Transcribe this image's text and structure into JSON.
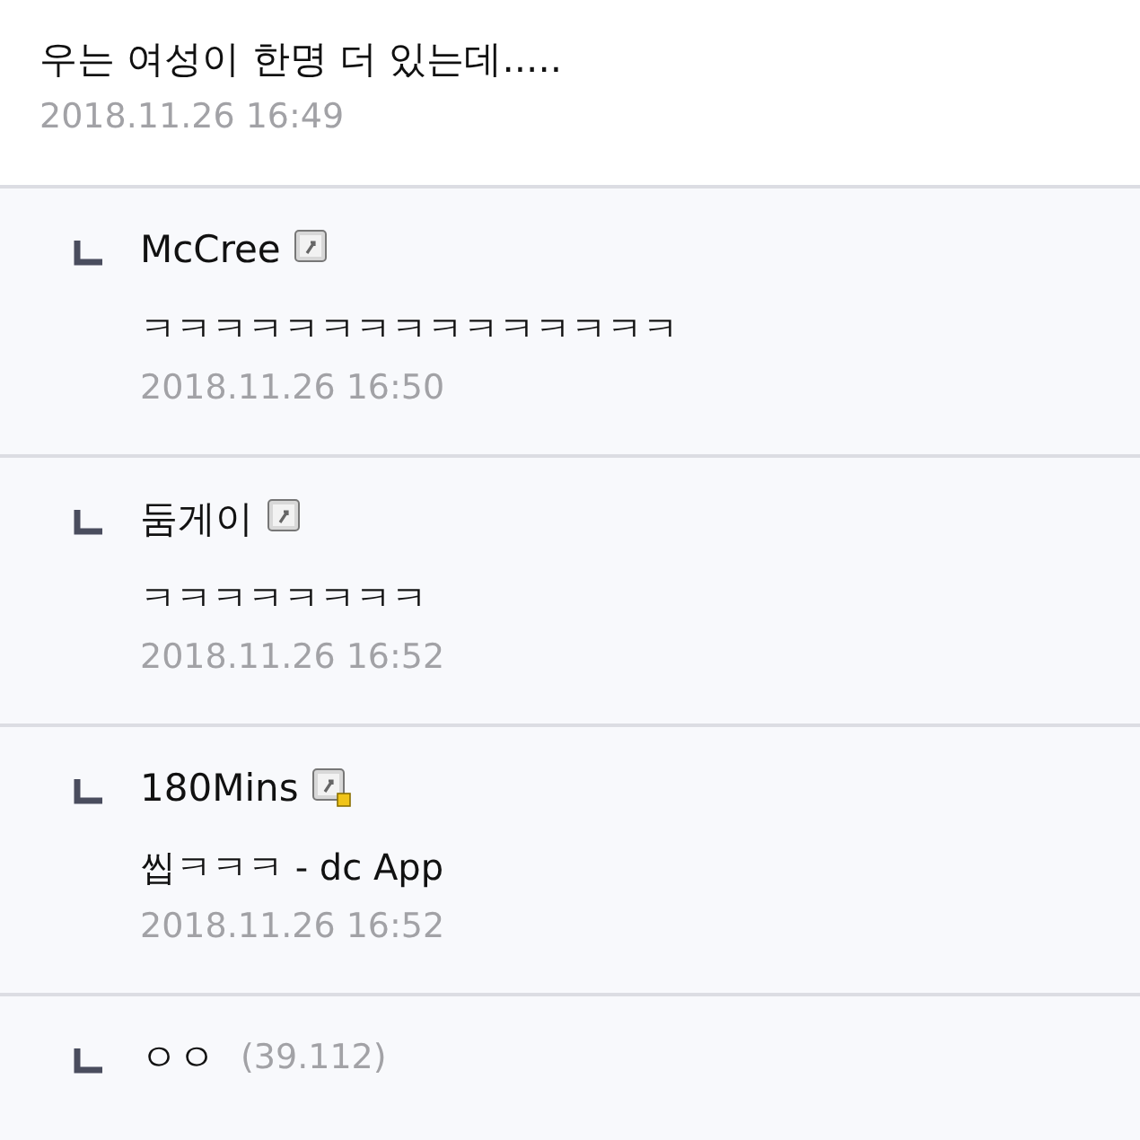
{
  "comment": {
    "text": "우는 여성이 한명 더 있는데.....",
    "date": "2018.11.26 16:49"
  },
  "replies": [
    {
      "author": "McCree",
      "kind": "fixed",
      "text": "ㅋㅋㅋㅋㅋㅋㅋㅋㅋㅋㅋㅋㅋㅋㅋ",
      "date": "2018.11.26 16:50"
    },
    {
      "author": "둠게이",
      "kind": "fixed",
      "text": "ㅋㅋㅋㅋㅋㅋㅋㅋ",
      "date": "2018.11.26 16:52"
    },
    {
      "author": "180Mins",
      "kind": "new",
      "text": "씹ㅋㅋㅋ - dc App",
      "date": "2018.11.26 16:52"
    },
    {
      "author": "ㅇㅇ",
      "ip": "(39.112)"
    }
  ]
}
